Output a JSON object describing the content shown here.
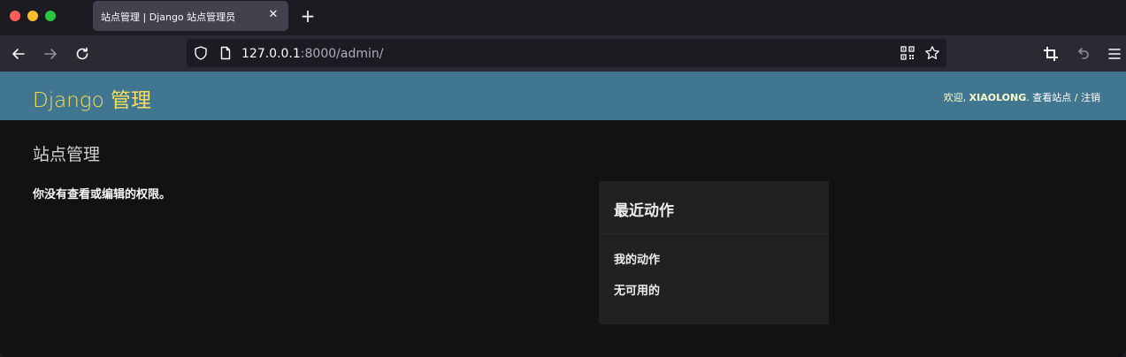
{
  "browser": {
    "tab_title": "站点管理 | Django 站点管理员",
    "url_host": "127.0.0.1",
    "url_rest": ":8000/admin/"
  },
  "header": {
    "branding": "Django 管理",
    "welcome": "欢迎,",
    "username": "XIAOLONG",
    "view_site": "查看站点",
    "separator": "/",
    "logout": "注销"
  },
  "main": {
    "title": "站点管理",
    "no_permission": "你没有查看或编辑的权限。"
  },
  "recent_actions": {
    "title": "最近动作",
    "my_actions": "我的动作",
    "none_available": "无可用的"
  },
  "colors": {
    "header_bg": "#417690",
    "branding": "#f5dd5d",
    "page_bg": "#121212",
    "module_bg": "#212121"
  }
}
